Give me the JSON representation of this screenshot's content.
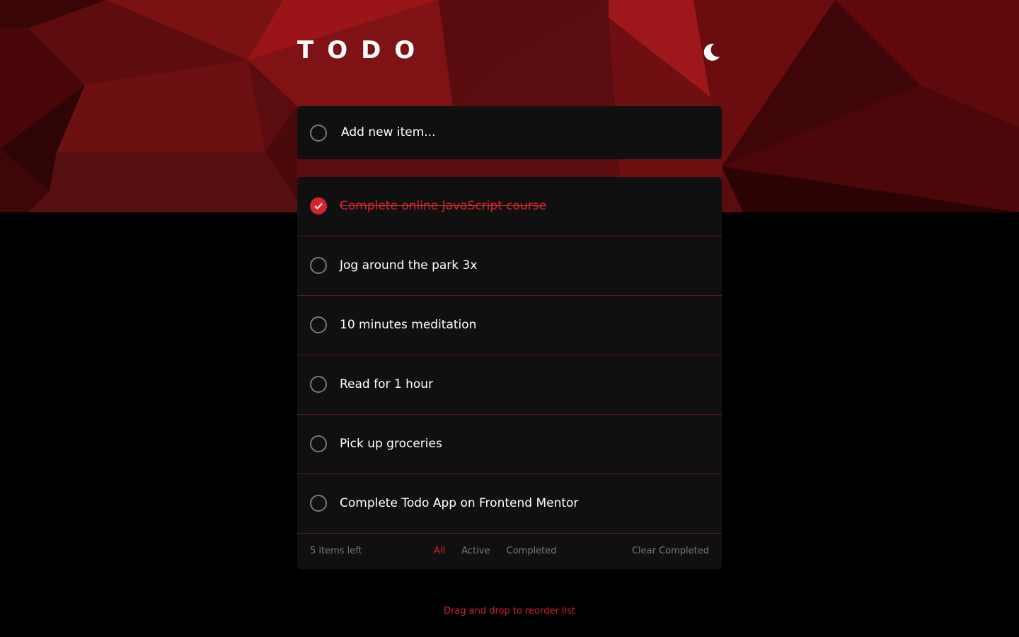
{
  "app": {
    "title": "TODO",
    "theme_toggle_icon": "moon-icon"
  },
  "new_item": {
    "placeholder": "Add new item..."
  },
  "todos": [
    {
      "text": "Complete online JavaScript course",
      "completed": true
    },
    {
      "text": "Jog around the park 3x",
      "completed": false
    },
    {
      "text": "10 minutes meditation",
      "completed": false
    },
    {
      "text": "Read for 1 hour",
      "completed": false
    },
    {
      "text": "Pick up groceries",
      "completed": false
    },
    {
      "text": "Complete Todo App on Frontend Mentor",
      "completed": false
    }
  ],
  "footer": {
    "items_left": "5 items left",
    "filters": [
      "All",
      "Active",
      "Completed"
    ],
    "active_filter": "All",
    "clear_label": "Clear Completed"
  },
  "hint": "Drag and drop to reorder list",
  "colors": {
    "accent": "#d3262c",
    "card_bg": "#101011",
    "page_bg": "#000000"
  }
}
